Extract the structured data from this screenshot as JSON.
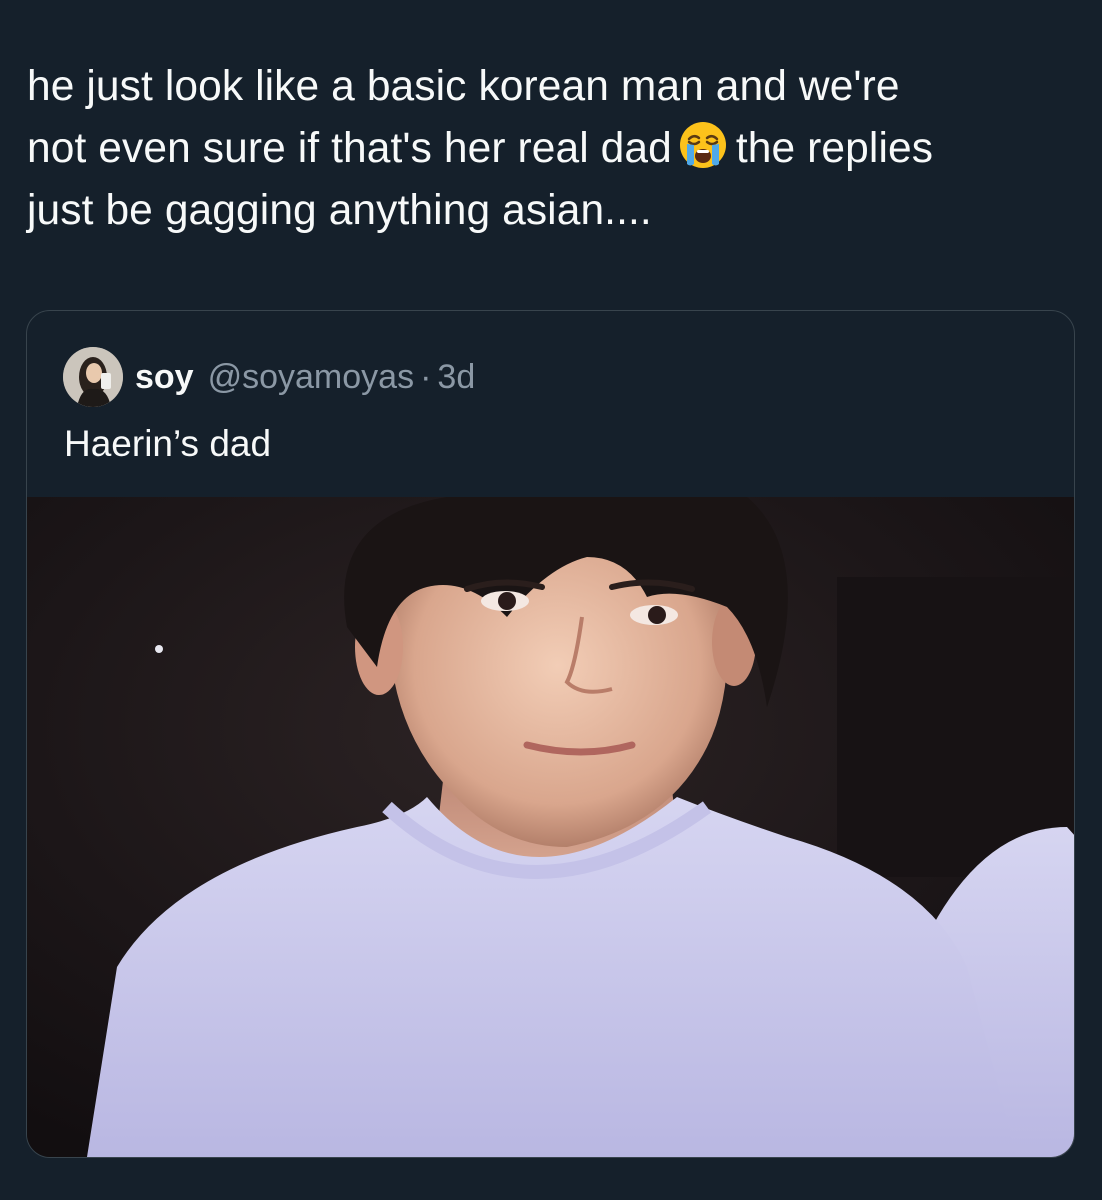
{
  "tweet": {
    "line1": "he just look like a basic korean man and we're",
    "line2a": "not even sure if that's her real dad",
    "emoji": "loudly-crying-face-emoji",
    "line2b": "the replies",
    "line3": "just be gagging anything asian...."
  },
  "quote": {
    "author_name": "soy",
    "author_handle": "@soyamoyas",
    "separator": "·",
    "timestamp": "3d",
    "text": "Haerin’s dad"
  },
  "colors": {
    "background": "#15202b",
    "border": "#38444d",
    "primary_text": "#f7f9f9",
    "secondary_text": "#8b98a5"
  }
}
